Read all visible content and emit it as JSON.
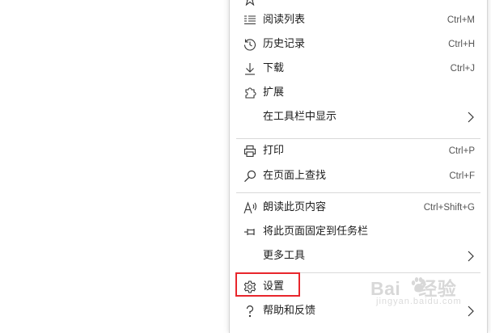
{
  "menu": {
    "items": [
      {
        "label": "阅读列表",
        "shortcut": "Ctrl+M",
        "icon": "reading-list-icon"
      },
      {
        "label": "历史记录",
        "shortcut": "Ctrl+H",
        "icon": "history-icon"
      },
      {
        "label": "下载",
        "shortcut": "Ctrl+J",
        "icon": "download-icon"
      },
      {
        "label": "扩展",
        "shortcut": "",
        "icon": "extensions-icon"
      },
      {
        "label": "在工具栏中显示",
        "shortcut": "",
        "icon": "",
        "submenu": true
      },
      {
        "label": "打印",
        "shortcut": "Ctrl+P",
        "icon": "print-icon"
      },
      {
        "label": "在页面上查找",
        "shortcut": "Ctrl+F",
        "icon": "find-icon"
      },
      {
        "label": "朗读此页内容",
        "shortcut": "Ctrl+Shift+G",
        "icon": "read-aloud-icon"
      },
      {
        "label": "将此页面固定到任务栏",
        "shortcut": "",
        "icon": "pin-icon"
      },
      {
        "label": "更多工具",
        "shortcut": "",
        "icon": "",
        "submenu": true
      },
      {
        "label": "设置",
        "shortcut": "",
        "icon": "gear-icon",
        "highlighted": true
      },
      {
        "label": "帮助和反馈",
        "shortcut": "",
        "icon": "help-icon",
        "submenu": true
      }
    ]
  },
  "watermark": {
    "text_left": "Bai",
    "text_right": "经验",
    "subtext": "jingyan.baidu.com"
  },
  "colors": {
    "highlight_border": "#e8262c",
    "text": "#1b1b1b",
    "shortcut": "#555555",
    "separator": "#d9d9d9"
  }
}
